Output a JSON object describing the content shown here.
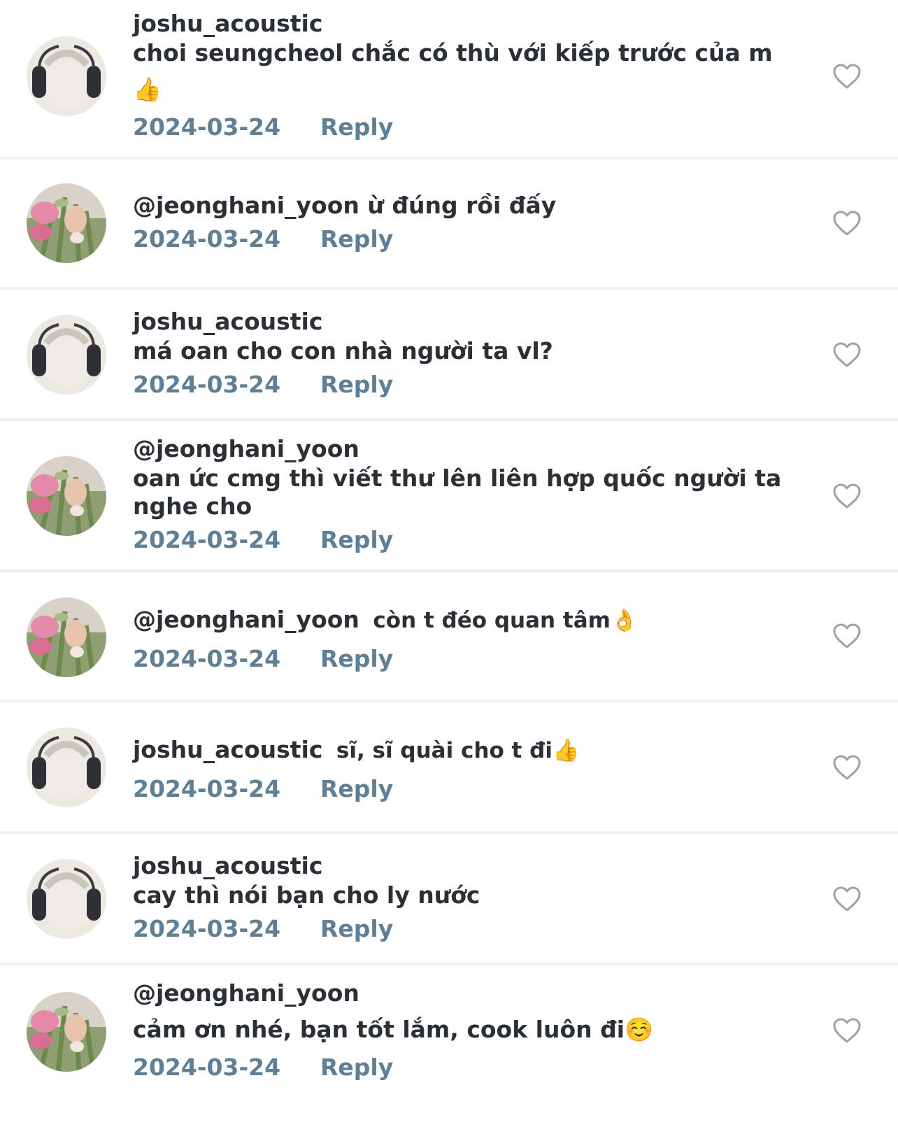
{
  "comments": [
    {
      "author": "joshu_acoustic",
      "avatar": "headphones",
      "text_line1": "choi seungcheol chắc có thù với kiếp trước của m",
      "text_line2": "👍",
      "date": "2024-03-24",
      "reply_label": "Reply",
      "like_icon": "heart-outline-icon"
    },
    {
      "author": "",
      "avatar": "flowers",
      "mention_inline": "@jeonghani_yoon ừ đúng rồi đấy",
      "date": "2024-03-24",
      "reply_label": "Reply",
      "like_icon": "heart-outline-icon"
    },
    {
      "author": "joshu_acoustic",
      "avatar": "headphones",
      "text_line1": "má oan cho con nhà người ta vl?",
      "date": "2024-03-24",
      "reply_label": "Reply",
      "like_icon": "heart-outline-icon"
    },
    {
      "author": "@jeonghani_yoon",
      "avatar": "flowers",
      "text_line1": "oan ức cmg thì viết thư lên liên hợp quốc người ta",
      "text_line2": "nghe cho",
      "date": "2024-03-24",
      "reply_label": "Reply",
      "like_icon": "heart-outline-icon"
    },
    {
      "author": "@jeonghani_yoon",
      "avatar": "flowers",
      "inline_text": "còn t đéo quan tâm👌",
      "date": "2024-03-24",
      "reply_label": "Reply",
      "like_icon": "heart-outline-icon"
    },
    {
      "author": "joshu_acoustic",
      "avatar": "headphones",
      "inline_text": "sĩ, sĩ quài cho t đi👍",
      "date": "2024-03-24",
      "reply_label": "Reply",
      "like_icon": "heart-outline-icon"
    },
    {
      "author": "joshu_acoustic",
      "avatar": "headphones",
      "text_line1": "cay thì nói bạn cho ly nước",
      "date": "2024-03-24",
      "reply_label": "Reply",
      "like_icon": "heart-outline-icon"
    },
    {
      "author": "@jeonghani_yoon",
      "avatar": "flowers",
      "text_line1": "cảm ơn nhé, bạn tốt lắm, cook luôn đi☺️",
      "date": "2024-03-24",
      "reply_label": "Reply",
      "like_icon": "heart-outline-icon"
    }
  ],
  "colors": {
    "text": "#2b2f36",
    "meta": "#5f7f96",
    "divider": "#eef1f5",
    "icon": "#9aa3ab"
  }
}
